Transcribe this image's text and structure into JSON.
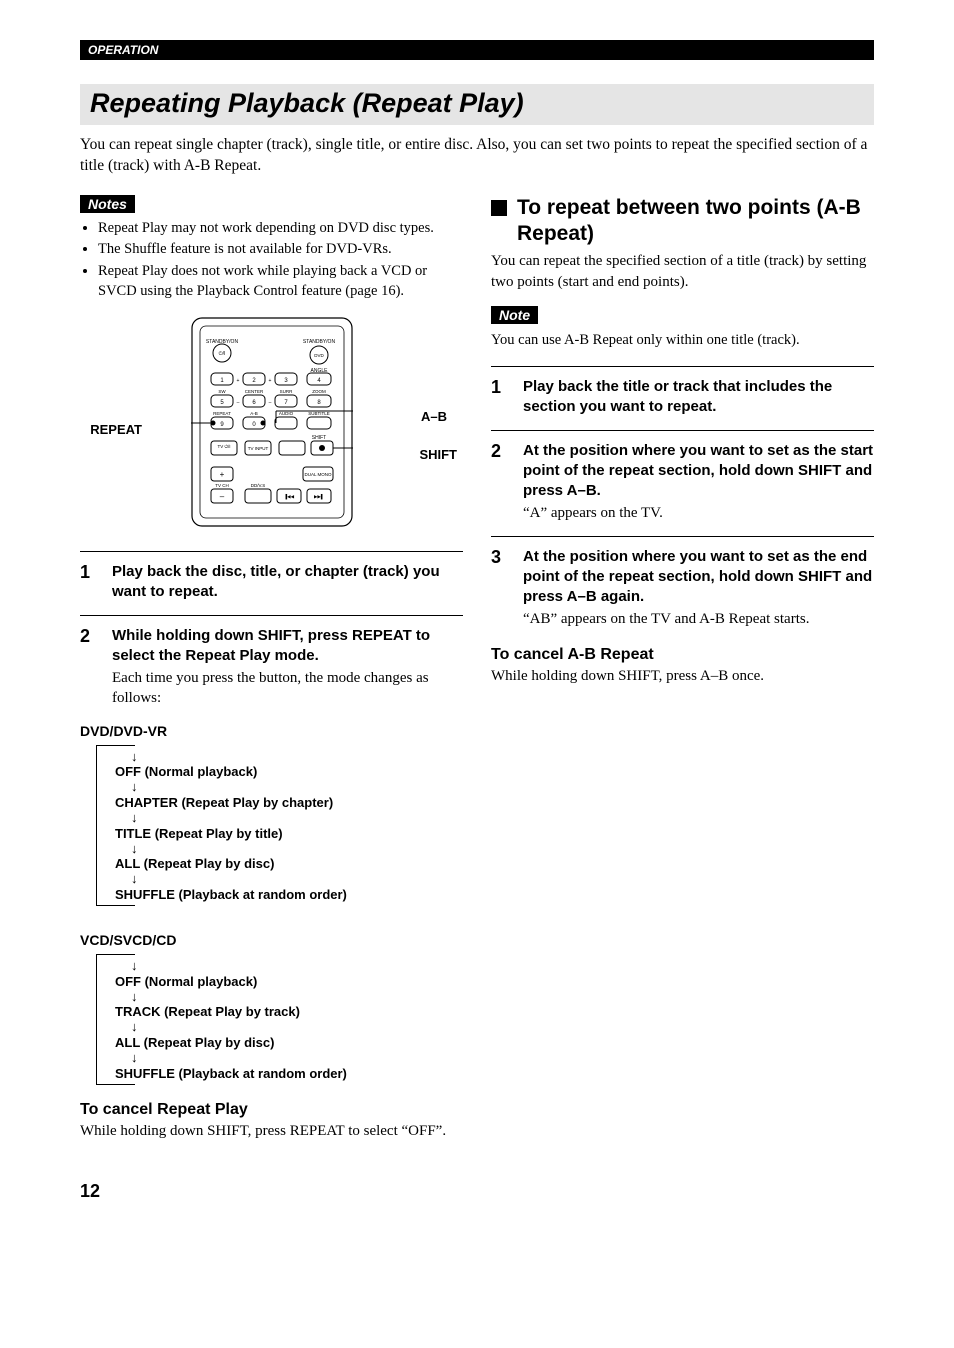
{
  "header": {
    "section": "OPERATION"
  },
  "title": "Repeating Playback (Repeat Play)",
  "intro": "You can repeat single chapter (track), single title, or entire disc. Also, you can set two points to repeat the specified section of a title (track) with A-B Repeat.",
  "left": {
    "notes_label": "Notes",
    "notes": [
      "Repeat Play may not work depending on DVD disc types.",
      "The Shuffle feature is not available for DVD-VRs.",
      "Repeat Play does not work while playing back a VCD or SVCD using the Playback Control feature (page 16)."
    ],
    "remote_callouts": {
      "repeat": "REPEAT",
      "ab": "A–B",
      "shift": "SHIFT"
    },
    "remote_labels": {
      "standby1": "STANDBY/ON",
      "standby2": "STANDBY/ON",
      "dvd": "DVD",
      "angle": "ANGLE",
      "zoom": "ZOOM",
      "sw": "SW",
      "center": "CENTER",
      "surr": "SURR",
      "repeat": "REPEAT",
      "ab": "A-B",
      "audio": "AUDIO",
      "subtitle": "SUBTITLE",
      "shift": "SHIFT",
      "tvpower": "TV",
      "tvinput": "TV INPUT",
      "tvch": "TV CH",
      "ddvs": "DD/V.S",
      "dual": "DUAL MONO",
      "n1": "1",
      "n2": "2",
      "n3": "3",
      "n4": "4",
      "n5": "5",
      "n6": "6",
      "n7": "7",
      "n8": "8",
      "n9": "9",
      "n0": "0",
      "plus": "+",
      "minus": "–"
    },
    "steps": [
      {
        "num": "1",
        "bold": "Play back the disc, title, or chapter (track) you want to repeat."
      },
      {
        "num": "2",
        "bold": "While holding down SHIFT, press REPEAT to select the Repeat Play mode.",
        "plain": "Each time you press the button, the mode changes as follows:"
      }
    ],
    "mode_groups": [
      {
        "heading": "DVD/DVD-VR",
        "items": [
          "OFF (Normal playback)",
          "CHAPTER (Repeat Play by chapter)",
          "TITLE (Repeat Play by title)",
          "ALL (Repeat Play by disc)",
          "SHUFFLE (Playback at random order)"
        ]
      },
      {
        "heading": "VCD/SVCD/CD",
        "items": [
          "OFF (Normal playback)",
          "TRACK (Repeat Play by track)",
          "ALL (Repeat Play by disc)",
          "SHUFFLE (Playback at random order)"
        ]
      }
    ],
    "cancel": {
      "heading": "To cancel Repeat Play",
      "body": "While holding down SHIFT, press REPEAT to select “OFF”."
    }
  },
  "right": {
    "heading": "To repeat between two points (A-B Repeat)",
    "intro": "You can repeat the specified section of a title (track) by setting two points (start and end points).",
    "note_label": "Note",
    "note_body": "You can use A-B Repeat only within one title (track).",
    "steps": [
      {
        "num": "1",
        "bold": "Play back the title or track that includes the section you want to repeat."
      },
      {
        "num": "2",
        "bold": "At the position where you want to set as the start point of the repeat section, hold down SHIFT and press A–B.",
        "plain": "“A” appears on the TV."
      },
      {
        "num": "3",
        "bold": "At the position where you want to set as the end point of the repeat section, hold down SHIFT and press A–B again.",
        "plain": "“AB” appears on the TV and A-B Repeat starts."
      }
    ],
    "cancel": {
      "heading": "To cancel A-B Repeat",
      "body": "While holding down SHIFT, press A–B once."
    }
  },
  "page_number": "12",
  "chart_data": null
}
